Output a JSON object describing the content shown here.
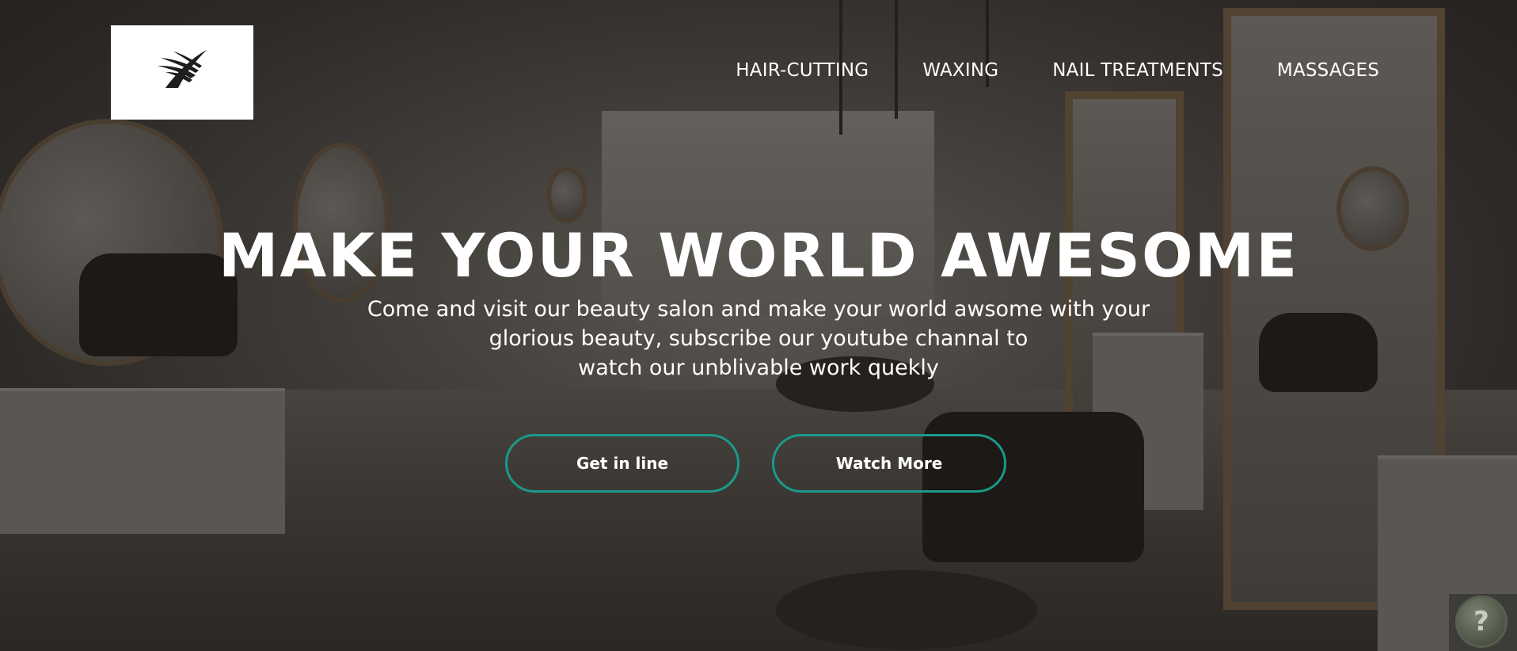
{
  "logo": {
    "icon": "wing-icon"
  },
  "nav": {
    "items": [
      {
        "label": "HAIR-CUTTING"
      },
      {
        "label": "WAXING"
      },
      {
        "label": "NAIL TREATMENTS"
      },
      {
        "label": "MASSAGES"
      }
    ]
  },
  "hero": {
    "headline": "MAKE YOUR WORLD AWESOME",
    "subtitle_lines": [
      "Come and visit our beauty salon and make your world awsome with your",
      "glorious beauty, subscribe our youtube channal to",
      "watch our unblivable work quekly"
    ],
    "buttons": {
      "primary": "Get in line",
      "secondary": "Watch More"
    }
  },
  "badge": {
    "glyph": "🡑",
    "icon": "chat-bubble-icon"
  },
  "colors": {
    "accent": "#1a9a8a",
    "text": "#ffffff"
  }
}
